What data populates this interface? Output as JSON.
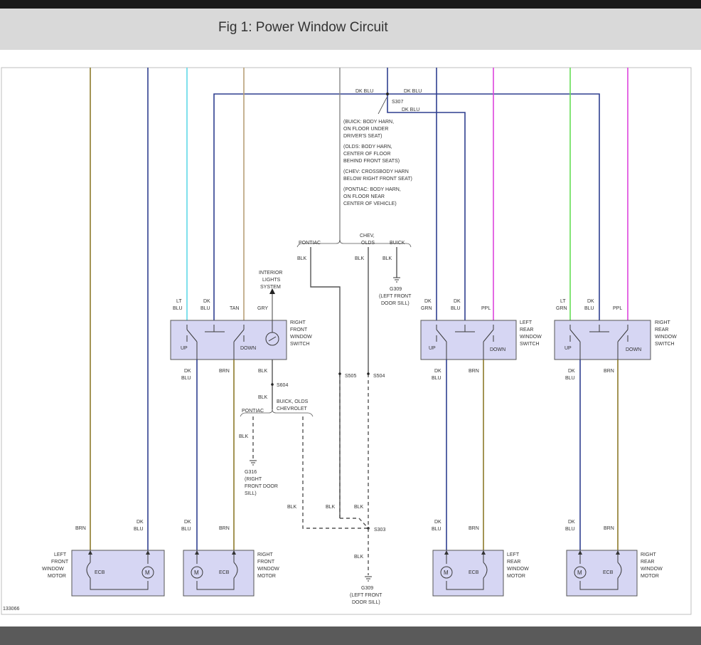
{
  "title": "Fig 1: Power Window Circuit",
  "figure_number": "133066",
  "colors": {
    "dk_blu": "#2f3f8f",
    "brn": "#8c7a2a",
    "tan": "#b8a078",
    "lt_blu": "#5fd8e8",
    "lt_grn": "#66dd55",
    "ppl": "#dd44dd",
    "gry": "#888888",
    "box_fill": "#d6d6f3"
  },
  "splice_s307": {
    "label": "S307",
    "wire_left": "DK BLU",
    "wire_right": "DK BLU",
    "wire_down": "DK BLU",
    "notes": [
      [
        "(BUICK: BODY HARN,",
        "ON FLOOR UNDER",
        "DRIVER'S SEAT)"
      ],
      [
        "(OLDS: BODY HARN,",
        "CENTER OF FLOOR",
        "BEHIND FRONT SEATS)"
      ],
      [
        "(CHEV: CROSSBODY HARN",
        "BELOW RIGHT FRONT SEAT)"
      ],
      [
        "(PONTIAC: BODY HARN,",
        "ON FLOOR NEAR",
        "CENTER OF VEHICLE)"
      ]
    ]
  },
  "ground_branch_top": {
    "pontiac": "PONTIAC",
    "chev_olds": [
      "CHEV,",
      "OLDS"
    ],
    "buick": "BUICK",
    "blk": "BLK",
    "g309": [
      "G309",
      "(LEFT FRONT",
      "DOOR SILL)"
    ]
  },
  "interior_lights": [
    "INTERIOR",
    "LIGHTS",
    "SYSTEM"
  ],
  "switches": {
    "right_front": {
      "name": [
        "RIGHT",
        "FRONT",
        "WINDOW",
        "SWITCH"
      ],
      "up": "UP",
      "down": "DOWN",
      "wires_top": [
        [
          "LT",
          "BLU"
        ],
        [
          "DK",
          "BLU"
        ],
        [
          "TAN"
        ],
        [
          "GRY"
        ]
      ],
      "wires_bottom": [
        [
          "DK",
          "BLU"
        ],
        [
          "BRN"
        ],
        [
          "BLK"
        ]
      ]
    },
    "left_rear": {
      "name": [
        "LEFT",
        "REAR",
        "WINDOW",
        "SWITCH"
      ],
      "up": "UP",
      "down": "DOWN",
      "wires_top": [
        [
          "DK",
          "GRN"
        ],
        [
          "DK",
          "BLU"
        ],
        [
          "PPL"
        ]
      ],
      "wires_bottom": [
        [
          "DK",
          "BLU"
        ],
        [
          "BRN"
        ]
      ]
    },
    "right_rear": {
      "name": [
        "RIGHT",
        "REAR",
        "WINDOW",
        "SWITCH"
      ],
      "up": "UP",
      "down": "DOWN",
      "wires_top": [
        [
          "LT",
          "GRN"
        ],
        [
          "DK",
          "BLU"
        ],
        [
          "PPL"
        ]
      ],
      "wires_bottom": [
        [
          "DK",
          "BLU"
        ],
        [
          "BRN"
        ]
      ]
    }
  },
  "s604": {
    "label": "S604",
    "blk": "BLK",
    "pontiac": "PONTIAC",
    "buick_olds_chev": [
      "BUICK, OLDS",
      "CHEVROLET"
    ],
    "g316": [
      "G316",
      "(RIGHT",
      "FRONT DOOR",
      "SILL)"
    ]
  },
  "s505": "S505",
  "s504": "S504",
  "s303": "S303",
  "blk": "BLK",
  "g309_bottom": [
    "G309",
    "(LEFT FRONT",
    "DOOR SILL)"
  ],
  "motors": {
    "left_front": {
      "name": [
        "LEFT",
        "FRONT",
        "WINDOW",
        "MOTOR"
      ],
      "ecb": "ECB",
      "m": "M",
      "wires": [
        [
          "BRN"
        ],
        [
          "DK",
          "BLU"
        ]
      ]
    },
    "right_front": {
      "name": [
        "RIGHT",
        "FRONT",
        "WINDOW",
        "MOTOR"
      ],
      "ecb": "ECB",
      "m": "M",
      "wires": [
        [
          "DK",
          "BLU"
        ],
        [
          "BRN"
        ]
      ]
    },
    "left_rear": {
      "name": [
        "LEFT",
        "REAR",
        "WINDOW",
        "MOTOR"
      ],
      "ecb": "ECB",
      "m": "M",
      "wires": [
        [
          "DK",
          "BLU"
        ],
        [
          "BRN"
        ]
      ]
    },
    "right_rear": {
      "name": [
        "RIGHT",
        "REAR",
        "WINDOW",
        "MOTOR"
      ],
      "ecb": "ECB",
      "m": "M",
      "wires": [
        [
          "DK",
          "BLU"
        ],
        [
          "BRN"
        ]
      ]
    }
  }
}
